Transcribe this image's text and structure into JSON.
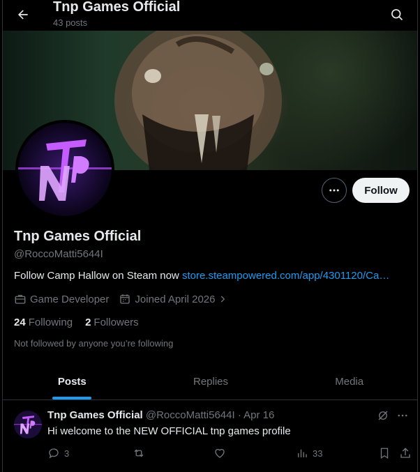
{
  "header": {
    "title": "Tnp Games Official",
    "post_count": "43 posts"
  },
  "icons": {
    "back": "arrow-left-icon",
    "search": "search-icon",
    "more": "more-horizontal-icon",
    "briefcase": "briefcase-icon",
    "calendar": "calendar-icon",
    "chevron": "chevron-right-icon",
    "grok": "grok-icon",
    "reply": "reply-icon",
    "repost": "repost-icon",
    "like": "heart-icon",
    "views": "views-icon",
    "bookmark": "bookmark-icon",
    "share": "share-icon"
  },
  "profile": {
    "name": "Tnp Games Official",
    "handle": "@RoccoMatti5644I",
    "bio_text": "Follow Camp Hallow on Steam now ",
    "bio_link": "store.steampowered.com/app/4301120/Ca…",
    "category": "Game Developer",
    "joined": "Joined April 2026",
    "following_count": "24",
    "following_label": "Following",
    "followers_count": "2",
    "followers_label": "Followers",
    "not_followed": "Not followed by anyone you’re following",
    "follow_button": "Follow"
  },
  "tabs": [
    {
      "label": "Posts",
      "active": true
    },
    {
      "label": "Replies",
      "active": false
    },
    {
      "label": "Media",
      "active": false
    }
  ],
  "post": {
    "author": "Tnp Games Official",
    "handle_date": "@RoccoMatti5644I · Apr 16",
    "text": "Hi welcome to the NEW OFFICIAL tnp games profile",
    "replies": "3",
    "views": "33"
  },
  "colors": {
    "background": "#000000",
    "accent": "#1d9bf0",
    "text": "#e7e9ea",
    "muted": "#71767b",
    "border": "#2f3336",
    "logo_purple": "#9b30ff"
  }
}
